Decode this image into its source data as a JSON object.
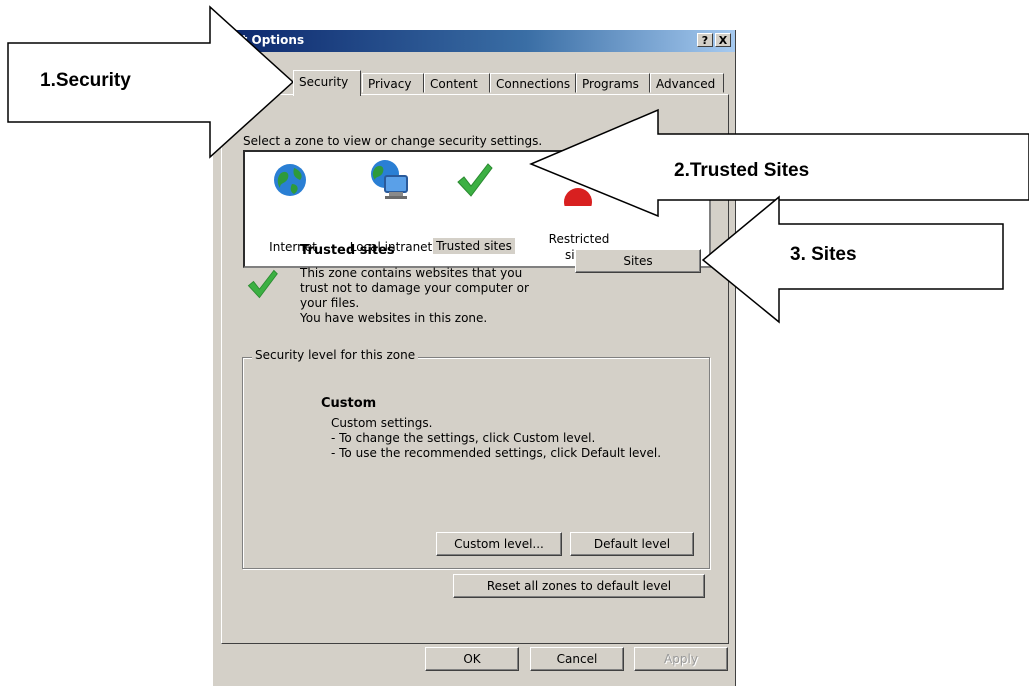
{
  "window": {
    "title": "rnet Options",
    "help_button": "?",
    "close_button": "X"
  },
  "tabs": [
    {
      "label": "Security",
      "active": true
    },
    {
      "label": "Privacy",
      "active": false
    },
    {
      "label": "Content",
      "active": false
    },
    {
      "label": "Connections",
      "active": false
    },
    {
      "label": "Programs",
      "active": false
    },
    {
      "label": "Advanced",
      "active": false
    }
  ],
  "zone_prompt": "Select a zone to view or change security settings.",
  "zones": [
    {
      "label": "Internet",
      "icon": "globe-icon"
    },
    {
      "label": "Local intranet",
      "icon": "network-computer-icon"
    },
    {
      "label": "Trusted sites",
      "icon": "checkmark-icon",
      "selected": true
    },
    {
      "label_line1": "Restricted",
      "label_line2": "sites",
      "icon": "restricted-icon"
    }
  ],
  "selected_zone": {
    "title": "Trusted sites",
    "description_lines": [
      "This zone contains websites that you",
      "trust not to damage your computer or",
      "your files.",
      "You have websites in this zone."
    ],
    "sites_button": "Sites"
  },
  "security_level": {
    "group_title": "Security level for this zone",
    "level_name": "Custom",
    "lines": [
      "Custom settings.",
      "- To change the settings, click Custom level.",
      "- To use the recommended settings, click Default level."
    ],
    "custom_button": "Custom level...",
    "default_button": "Default level"
  },
  "reset_button": "Reset all zones to default level",
  "footer": {
    "ok": "OK",
    "cancel": "Cancel",
    "apply": "Apply"
  },
  "annotations": [
    {
      "text": "1.Security"
    },
    {
      "text": "2.Trusted Sites"
    },
    {
      "text": "3. Sites"
    }
  ],
  "colors": {
    "dialog_face": "#d4d0c8",
    "titlebar_start": "#0a246a",
    "checkmark_green": "#3cb043",
    "selection": "#d4d0c8"
  }
}
